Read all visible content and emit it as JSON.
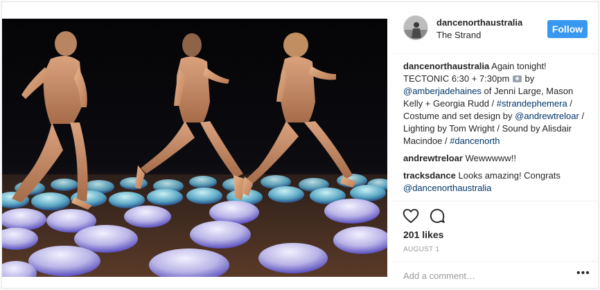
{
  "post": {
    "username": "dancenorthaustralia",
    "location": "The Strand",
    "follow_label": "Follow",
    "caption": {
      "username": "dancenorthaustralia",
      "text_1": " Again tonight! TECTONIC 6:30 + 7:30pm ",
      "text_2": " by ",
      "mention_1": "@amberjadehaines",
      "text_3": " of Jenni Large, Mason Kelly + Georgia Rudd / ",
      "hashtag_1": "#strandephemera",
      "text_4": " / Costume and set design by ",
      "mention_2": "@andrewtreloar",
      "text_5": " / Lighting by Tom Wright / Sound by Alisdair Macindoe / ",
      "hashtag_2": "#dancenorth"
    },
    "comments": [
      {
        "username": "andrewtreloar",
        "text": " Wewwwww!!"
      },
      {
        "username": "tracksdance",
        "text": " Looks amazing! Congrats ",
        "mention": "@dancenorthaustralia"
      }
    ],
    "likes": "201 likes",
    "date": "AUGUST 1",
    "comment_placeholder": "Add a comment…",
    "more_label": "•••"
  },
  "icons": {
    "like": "heart-icon",
    "comment": "comment-icon",
    "camera": "camera-emoji-icon",
    "more": "more-options-icon"
  },
  "colors": {
    "follow_button": "#3897f0",
    "link": "#003569",
    "muted": "#999999",
    "text": "#262626",
    "border": "#efefef"
  }
}
